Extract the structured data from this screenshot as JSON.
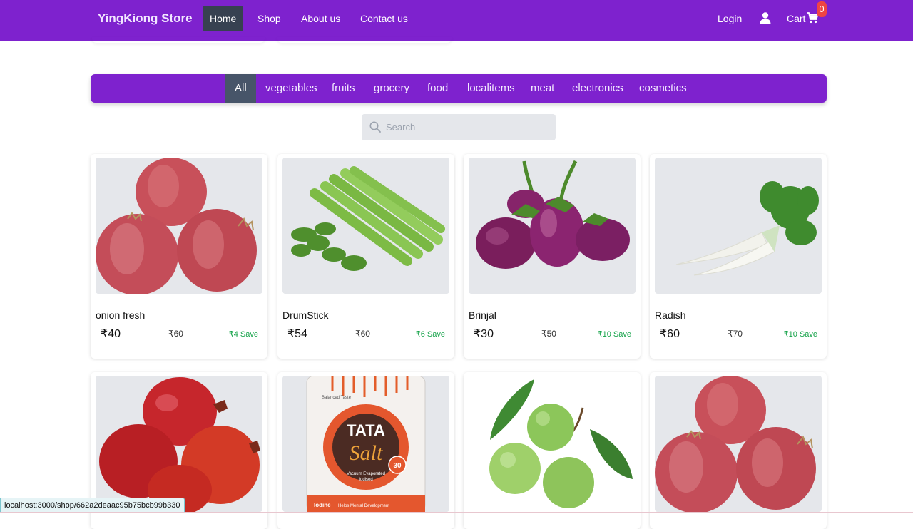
{
  "navbar": {
    "brand": "YingKiong Store",
    "links": [
      {
        "label": "Home",
        "active": true
      },
      {
        "label": "Shop",
        "active": false
      },
      {
        "label": "About us",
        "active": false
      },
      {
        "label": "Contact us",
        "active": false
      }
    ],
    "login": "Login",
    "cart_label": "Cart",
    "cart_count": "0",
    "user_icon": "user-icon",
    "cart_icon": "shopping-cart-icon"
  },
  "categories": {
    "items": [
      "All",
      "vegetables",
      "fruits",
      "grocery",
      "food",
      "localitems",
      "meat",
      "electronics",
      "cosmetics"
    ],
    "active": "All"
  },
  "search": {
    "placeholder": "Search",
    "value": "",
    "icon": "search-icon"
  },
  "products": [
    {
      "name": "onion fresh",
      "price": "₹40",
      "mrp": "₹60",
      "save": "₹4 Save",
      "image": "onion"
    },
    {
      "name": "DrumStick",
      "price": "₹54",
      "mrp": "₹60",
      "save": "₹6 Save",
      "image": "drumstick"
    },
    {
      "name": "Brinjal",
      "price": "₹30",
      "mrp": "₹50",
      "save": "₹10 Save",
      "image": "brinjal"
    },
    {
      "name": "Radish",
      "price": "₹60",
      "mrp": "₹70",
      "save": "₹10 Save",
      "image": "radish"
    },
    {
      "name": "",
      "price": "",
      "mrp": "",
      "save": "",
      "image": "pomegranate"
    },
    {
      "name": "",
      "price": "",
      "mrp": "",
      "save": "",
      "image": "tata-salt",
      "image_text": [
        "TATA",
        "Salt",
        "Vacuum Evaporated",
        "Iodised",
        "30",
        "Iodine",
        "Helps Mental Development",
        "Balanced Taste"
      ]
    },
    {
      "name": "",
      "price": "",
      "mrp": "",
      "save": "",
      "image": "guava"
    },
    {
      "name": "",
      "price": "",
      "mrp": "",
      "save": "",
      "image": "onion"
    }
  ],
  "status_bar": {
    "url": "localhost:3000/shop/662a2deaac95b75bcb99b330"
  },
  "colors": {
    "primary": "#7e22ce",
    "active_tab": "#374151",
    "badge": "#ef4444",
    "save_text": "#16a34a"
  }
}
